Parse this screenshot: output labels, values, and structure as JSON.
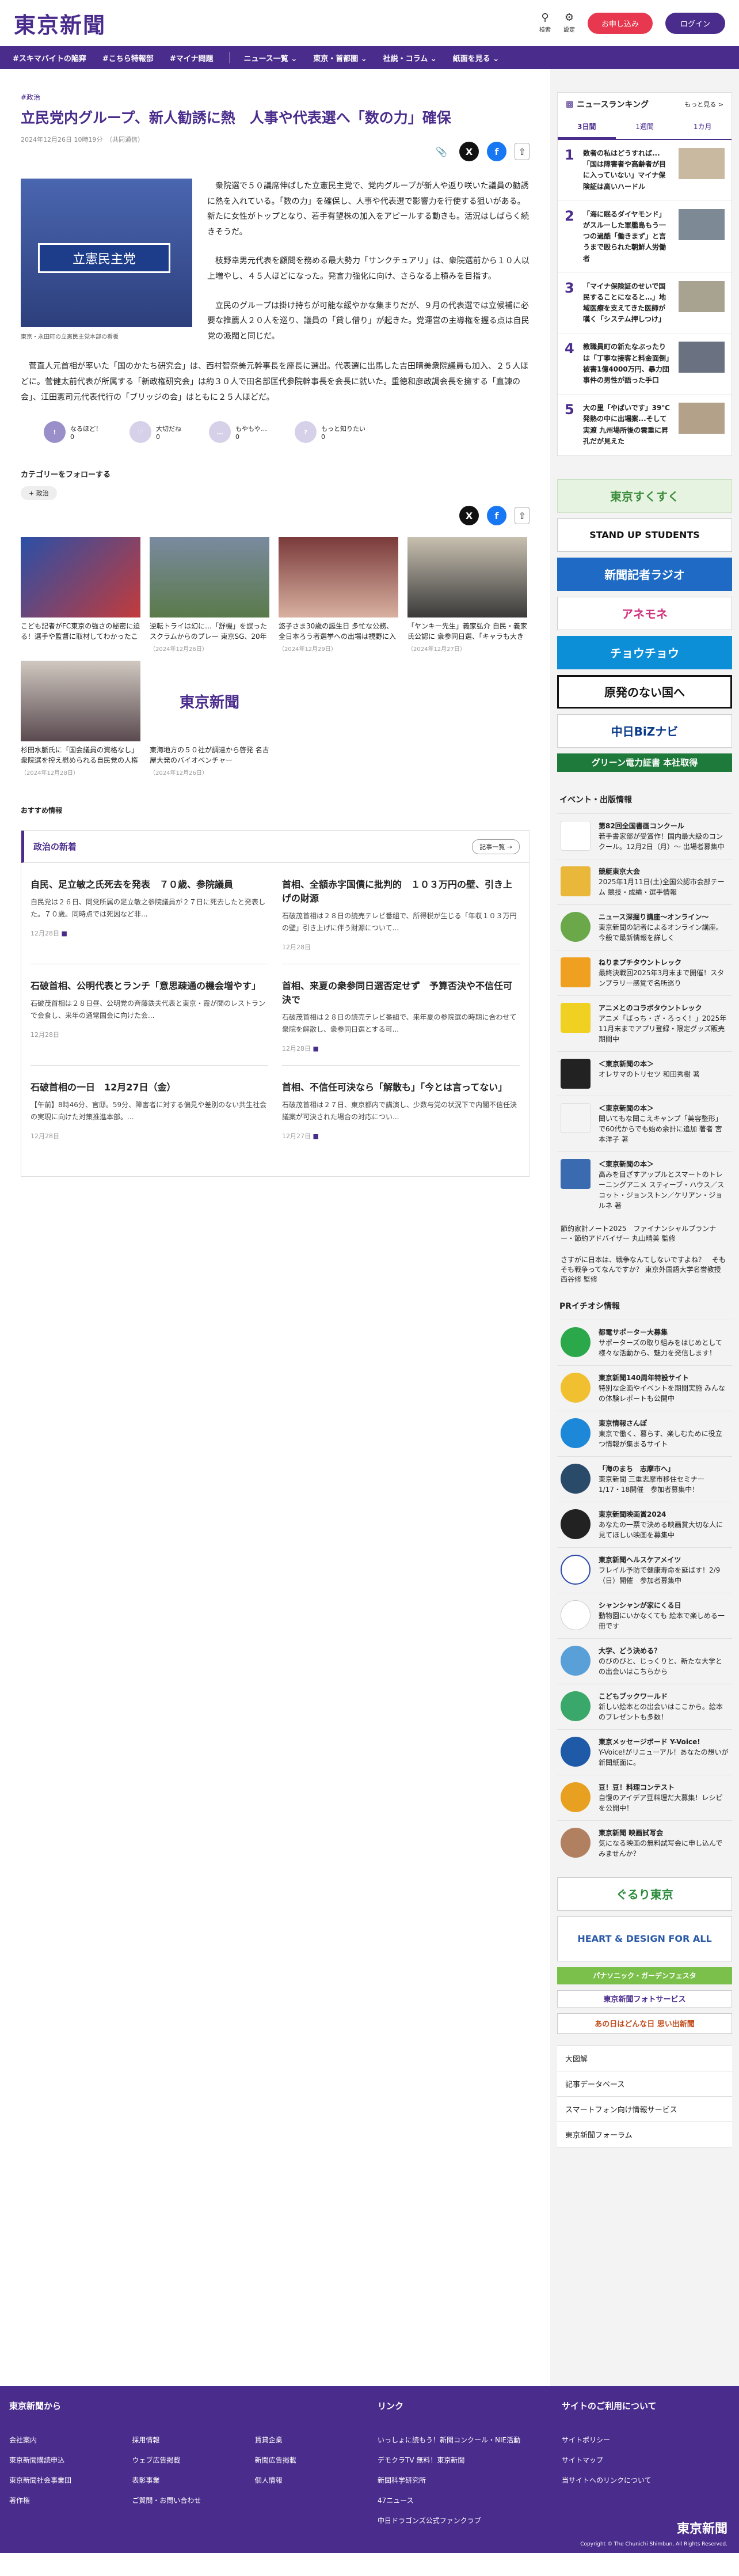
{
  "header": {
    "logo": "東京新聞",
    "search": "検索",
    "settings": "設定",
    "register": "お申し込み",
    "login": "ログイン"
  },
  "nav": {
    "items": [
      "#スキマバイトの陥穽",
      "#こちら特報部",
      "#マイナ問題"
    ],
    "menus": [
      "ニュース一覧 ⌄",
      "東京・首都圏 ⌄",
      "社説・コラム ⌄",
      "紙面を見る ⌄"
    ]
  },
  "article": {
    "tag": "#政治",
    "title": "立民党内グループ、新人勧誘に熱　人事や代表選へ「数の力」確保",
    "date": "2024年12月26日 10時19分　（共同通信）",
    "photo_sign": "立憲民主党",
    "caption": "東京・永田町の立憲民主党本部の看板",
    "paras": [
      "衆院選で５０議席伸ばした立憲民主党で、党内グループが新人や返り咲いた議員の勧誘に熱を入れている。「数の力」を確保し、人事や代表選で影響力を行使する狙いがある。新たに女性がトップとなり、若手有望株の加入をアピールする動きも。活況はしばらく続きそうだ。",
      "枝野幸男元代表を顧問を務める最大勢力「サンクチュアリ」は、衆院選前から１０人以上増やし、４５人ほどになった。発言力強化に向け、さらなる上積みを目指す。",
      "立民のグループは掛け持ちが可能な緩やかな集まりだが、９月の代表選では立候補に必要な推薦人２０人を巡り、議員の「貸し借り」が起きた。党運営の主導権を握る点は自民党の派閥と同じだ。"
    ],
    "last": "菅直人元首相が率いた「国のかたち研究会」は、西村智奈美元幹事長を座長に選出。代表選に出馬した吉田晴美衆院議員も加入、２５人ほどに。菅健太前代表が所属する「新政権研究会」は約３０人で田名部匡代参院幹事長を会長に就いた。重徳和彦政調会長を擁する「直諫の会」、江田憲司元代表代行の「ブリッジの会」はともに２５人ほどだ。"
  },
  "reactions": [
    {
      "label": "なるほど！",
      "count": "0"
    },
    {
      "label": "大切だね",
      "count": "0"
    },
    {
      "label": "もやもや…",
      "count": "0"
    },
    {
      "label": "もっと知りたい",
      "count": "0"
    }
  ],
  "follow": {
    "heading": "カテゴリーをフォローする",
    "chip": "+ 政治"
  },
  "related": [
    {
      "title": "こども記者がFC東京の強さの秘密に迫る！選手や監督に取材してわかったことは？",
      "date": ""
    },
    {
      "title": "逆転トライは幻に…「舒機」を誤ったスクラムからのプレー 東京SG、20年ぶり開幕連敗",
      "date": "（2024年12月26日）"
    },
    {
      "title": "悠子さま30歳の誕生日 多忙な公務、全日本ろう者選挙への出場は視野に入れ　ろう者に親しまれることも",
      "date": "（2024年12月29日）"
    },
    {
      "title": "「ヤンキー先生」義家弘介 自民・義家氏公認に 衆参同日選、「キャラも大きさも蹴し」 神奈川で出馬",
      "date": "（2024年12月27日）"
    },
    {
      "title": "杉田水脈氏に「国会議員の資格なし」 衆院選を控え慰められる自民党の人権感覚、公認しない…",
      "date": "（2024年12月28日）"
    },
    {
      "title": "東海地方の５０社が調達から啓発 名古屋大発のバイオベンチャー",
      "date": "（2024年12月26日）"
    }
  ],
  "recommend": "おすすめ情報",
  "latest": {
    "heading": "政治の新着",
    "more": "記事一覧 →",
    "items": [
      {
        "title": "自民、足立敏之氏死去を発表　７０歳、参院議員",
        "text": "自民党は２６日、同党所属の足立敏之参院議員が２７日に死去したと発表した。７０歳。同時点では死因など非...",
        "date": "12月28日"
      },
      {
        "title": "首相、全額赤字国債に批判的　１０３万円の壁、引き上げの財源",
        "text": "石破茂首相は２８日の読売テレビ番組で、所得税が生じる「年収１０３万円の壁」引き上げに伴う財源について...",
        "date": "12月28日"
      },
      {
        "title": "石破首相、公明代表とランチ「意思疎通の機会増やす」",
        "text": "石破茂首相は２８日昼、公明党の斉藤鉄夫代表と東京・霞が関のレストランで会食し、来年の通常国会に向けた会...",
        "date": "12月28日"
      },
      {
        "title": "首相、来夏の衆参同日選否定せず　予算否決や不信任可決で",
        "text": "石破茂首相は２８日の読売テレビ番組で、来年夏の参院選の時期に合わせて衆院を解散し、衆参同日選とする可...",
        "date": "12月28日"
      },
      {
        "title": "石破首相の一日　12月27日（金）",
        "text": "【午前】8時46分、官邸。59分、障害者に対する偏見や差別のない共生社会の実現に向けた対策推進本部。...",
        "date": "12月28日"
      },
      {
        "title": "首相、不信任可決なら「解散も」「今とは言ってない」",
        "text": "石破茂首相は２７日、東京都内で講演し、少数与党の状況下で内閣不信任決議案が可決された場合の対応につい...",
        "date": "12月27日"
      }
    ]
  },
  "ranking": {
    "heading": "ニュースランキング",
    "more": "もっと見る >",
    "tabs": [
      "3日間",
      "1週間",
      "1カ月"
    ],
    "items": [
      {
        "num": "1",
        "title": "数者の私はどうすれば...「国は障害者や高齢者が目に入っていない」マイナ保険証は高いハードル"
      },
      {
        "num": "2",
        "title": "「海に眠るダイヤモンド」がスルーした軍艦島もう一つの過酷「働きまず」と言うまで殴られた朝鮮人労働者"
      },
      {
        "num": "3",
        "title": "「マイナ保険証のせいで国民することになると…」地域医療を支えてきた医師が嘆く「システム押しつけ」"
      },
      {
        "num": "4",
        "title": "教職員町の新たなぶったりは「丁寧な接客と料金面倒」　被害1億4000万円、暴力団事件の男性が語った手口"
      },
      {
        "num": "5",
        "title": "大の里「やばいです」39℃発熱の中に出場案...そして実渡 九州場所後の雲重に昇孔だが見えた"
      }
    ]
  },
  "banners": [
    "東京すくすく",
    "STAND UP STUDENTS",
    "新聞記者ラジオ",
    "アネモネ",
    "チョウチョウ",
    "原発のない国へ",
    "中日BiZナビ",
    "グリーン電力証書 本社取得"
  ],
  "events": {
    "heading": "イベント・出版情報",
    "items": [
      {
        "title": "第82回全国書画コンクール",
        "text": "若手書家部が受賞作！国内最大級のコンクール。12月2日（月）～ 出場者募集中"
      },
      {
        "title": "競艇東京大会",
        "text": "2025年1月11日(土)全国公認市会部テーム 競技・成績・選手情報"
      },
      {
        "title": "ニュース深掘り講座～オンライン～",
        "text": "東京新聞の記者によるオンライン講座。今般で最新情報を詳しく"
      },
      {
        "title": "ねりまプチタウントレック",
        "text": "最終決戦回2025年3月末まで開催！スタンプラリー感覚で名所巡り"
      },
      {
        "title": "アニメとのコラボタウントレック",
        "text": "アニメ「ばっち・ざ・ろっく！」2025年11月末までアプリ登録・限定グッズ販売期間中"
      },
      {
        "title": "＜東京新聞の本＞",
        "text": "オレサマのトリセツ 和田秀樹 著"
      },
      {
        "title": "＜東京新聞の本＞",
        "text": "聞いてもな聞こえキャンプ「美容整形」で60代からでも始め余計に追加 著者 宮本洋子 著"
      },
      {
        "title": "＜東京新聞の本＞",
        "text": "高みを目ざすアップルとスマートのトレーニングアニメ スティーブ・ハウス／スコット・ジョンストン／ケリアン・ジョルネ 著"
      }
    ],
    "links": [
      "節約家計ノート2025　ファイナンシャルプランナー・節約アドバイザー 丸山晴美 監修",
      "さすがに日本は、戦争なんてしないですよね？　そもそも戦争ってなんですか？ 東京外国語大学名誉教授 西谷修 監修"
    ]
  },
  "pr": {
    "heading": "PRイチオシ情報",
    "items": [
      {
        "title": "都電サポーター大募集",
        "text": "サポーターズの取り組みをはじめとして様々な活動から、魅力を発信します！"
      },
      {
        "title": "東京新聞140周年特設サイト",
        "text": "特別な企画やイベントを期間実施 みんなの体験レポートも公開中"
      },
      {
        "title": "東京情報さんぽ",
        "text": "東京で働く、暮らす、楽しむために役立つ情報が集まるサイト"
      },
      {
        "title": "「海のまち　志摩市へ」",
        "text": "東京新聞 三重志摩市移住セミナー 1/17・18開催　参加者募集中！"
      },
      {
        "title": "東京新聞映画賞2024",
        "text": "あなたの一票で決める映画賞大切な人に見てほしい映画を募集中"
      },
      {
        "title": "東京新聞ヘルスケアメイツ",
        "text": "フレイル予防で健康寿命を延ばす！2/9（日）開催　参加者募集中"
      },
      {
        "title": "シャンシャンが家にくる日",
        "text": "動物園にいかなくても 絵本で楽しめる一冊です"
      },
      {
        "title": "大学、どう決める？",
        "text": "のびのびと、じっくりと、新たな大学との出会いはこちらから"
      },
      {
        "title": "こどもブックワールド",
        "text": "新しい絵本との出会いはここから。絵本のプレゼントも多数！"
      },
      {
        "title": "東京メッセージボード Y-Voice!",
        "text": "Y-Voice!がリニューアル！あなたの想いが新聞紙面に。"
      },
      {
        "title": "豆！豆！料理コンテスト",
        "text": "自慢のアイデア豆料理だ大募集！レシピを公開中！"
      },
      {
        "title": "東京新聞 映画試写会",
        "text": "気になる映画の無料試写会に申し込んでみませんか？"
      }
    ]
  },
  "bottom_banners": [
    "ぐるり東京",
    "HEART & DESIGN FOR ALL",
    "パナソニック・ガーデンフェスタ",
    "東京新聞フォトサービス",
    "あの日はどんな日 思い出新聞"
  ],
  "bottom_links": [
    "大図解",
    "記事データベース",
    "スマートフォン向け情報サービス",
    "東京新聞フォーラム"
  ],
  "footer": {
    "col1_heading": "東京新聞から",
    "col1": [
      "会社案内",
      "採用情報",
      "賃貸企業",
      "東京新聞購読申込",
      "ウェブ広告掲載",
      "新聞広告掲載",
      "東京新聞社会事業団",
      "表彰事業",
      "個人情報",
      "著作権",
      "ご質問・お問い合わせ"
    ],
    "col2_heading": "リンク",
    "col2": [
      "いっしょに読もう！新聞コンクール・NIE活動",
      "デモクラTV 無料！東京新聞",
      "新聞科学研究所",
      "47ニュース",
      "中日ドラゴンズ公式ファンクラブ"
    ],
    "col3_heading": "サイトのご利用について",
    "col3": [
      "サイトポリシー",
      "サイトマップ",
      "当サイトへのリンクについて"
    ],
    "logo": "東京新聞",
    "copyright": "Copyright © The Chunichi Shimbun, All Rights Reserved."
  }
}
